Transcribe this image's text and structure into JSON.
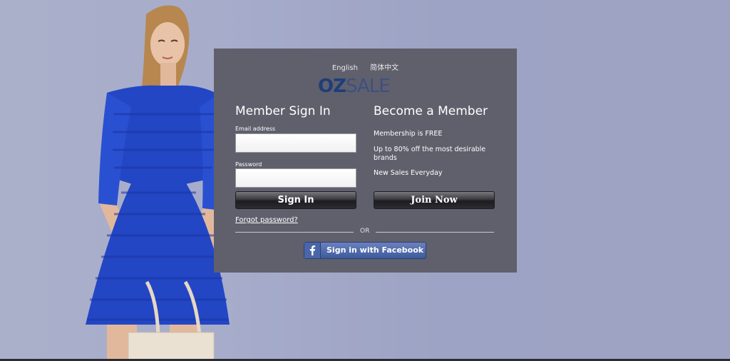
{
  "languages": [
    "English",
    "简体中文"
  ],
  "logo": {
    "part1": "OZ",
    "part2": "SALE"
  },
  "signin": {
    "title": "Member Sign In",
    "email_label": "Email address",
    "email_value": "",
    "password_label": "Password",
    "password_value": "",
    "button": "Sign In",
    "forgot": "Forgot password?"
  },
  "member": {
    "title": "Become a Member",
    "benefits": [
      "Membership is FREE",
      "Up to 80% off the most desirable brands",
      "New Sales Everyday"
    ],
    "button": "Join Now"
  },
  "divider": "OR",
  "facebook": {
    "button": "Sign in with Facebook"
  },
  "colors": {
    "panel": "#5f606c",
    "background": "#a7accb",
    "facebook": "#3d5a9c",
    "logo": "#1f3d7a"
  },
  "icons": {
    "facebook": "facebook-icon"
  }
}
